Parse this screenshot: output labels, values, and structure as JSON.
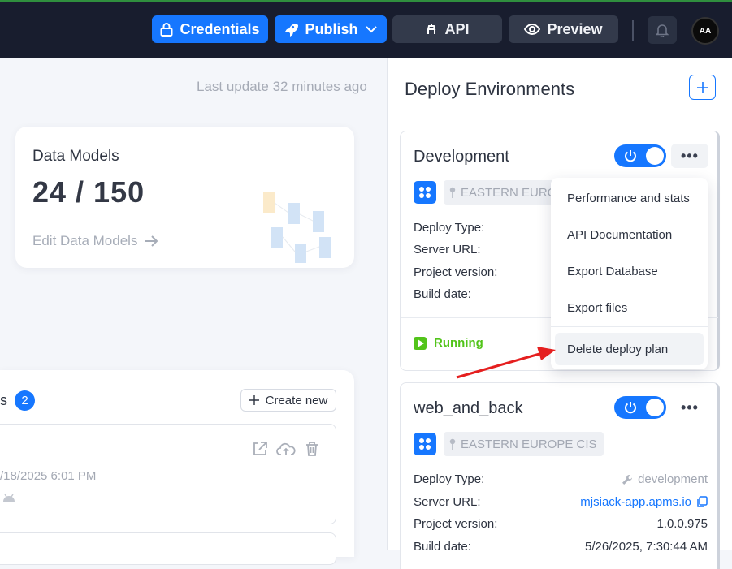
{
  "topbar": {
    "credentials_label": "Credentials",
    "publish_label": "Publish",
    "api_label": "API",
    "preview_label": "Preview",
    "avatar_text": "AA",
    "accent": "#1677ff"
  },
  "main": {
    "last_update": "Last update 32 minutes ago",
    "data_models": {
      "title": "Data Models",
      "value": "24 / 150",
      "link": "Edit Data Models"
    },
    "projects": {
      "title_fragment": "s",
      "count": "2",
      "create_label": "Create new",
      "items": [
        {
          "date": "/18/2025 6:01 PM"
        }
      ]
    }
  },
  "deploy_panel": {
    "title": "Deploy Environments",
    "environments": [
      {
        "name": "Development",
        "enabled": true,
        "region": "EASTERN EUROPE",
        "labels": [
          "Deploy Type:",
          "Server URL:",
          "Project version:",
          "Build date:"
        ],
        "status": "Running"
      },
      {
        "name": "web_and_back",
        "enabled": true,
        "region": "EASTERN EUROPE CIS",
        "labels": [
          "Deploy Type:",
          "Server URL:",
          "Project version:",
          "Build date:"
        ],
        "deploy_type": "development",
        "server_url": "mjsiack-app.apms.io",
        "project_version": "1.0.0.975",
        "build_date": "5/26/2025, 7:30:44 AM"
      }
    ]
  },
  "context_menu": {
    "items": [
      "Performance and stats",
      "API Documentation",
      "Export Database",
      "Export files",
      "Delete deploy plan"
    ],
    "highlighted": "Delete deploy plan"
  },
  "colors": {
    "running": "#52c41a",
    "annotation_arrow": "#e51f1f"
  }
}
